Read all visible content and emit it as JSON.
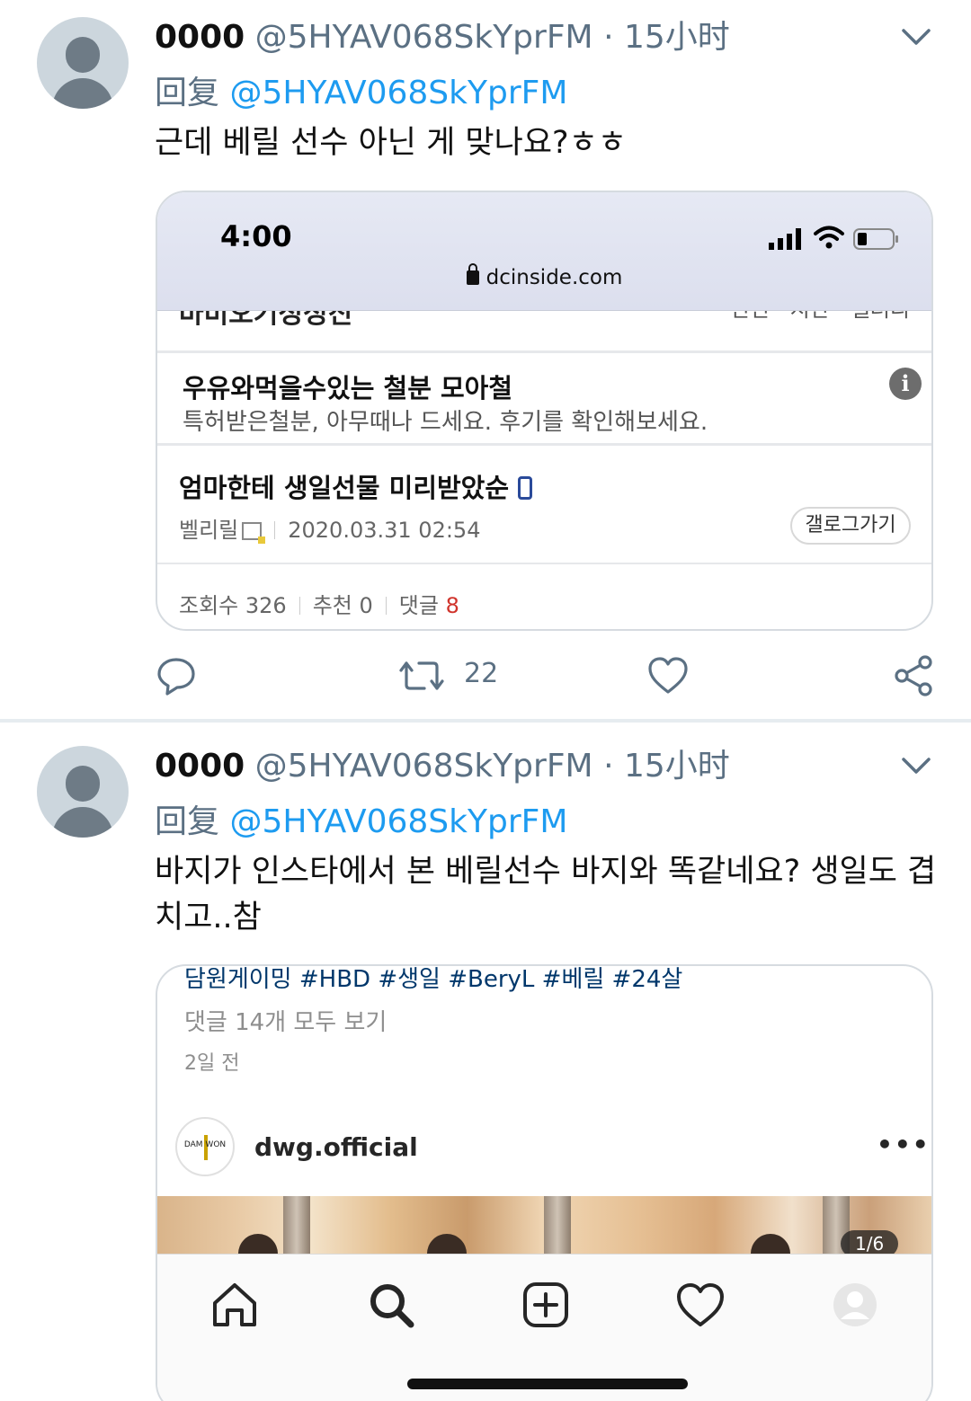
{
  "tweets": [
    {
      "name": "0000",
      "handle": "@5HYAV068SkYprFM",
      "dot": "·",
      "time": "15小时",
      "reply_word": "回复",
      "reply_to": "@5HYAV068SkYprFM",
      "text": "근데 베릴 선수 아닌 게 맞나요?ㅎㅎ"
    },
    {
      "name": "0000",
      "handle": "@5HYAV068SkYprFM",
      "dot": "·",
      "time": "15小时",
      "reply_word": "回复",
      "reply_to": "@5HYAV068SkYprFM",
      "text": "바지가 인스타에서 본 베릴선수 바지와 똑같네요? 생일도 겹치고..참"
    }
  ],
  "card1": {
    "clock": "4:00",
    "url": "dcinside.com",
    "cut_text": "바비오기정정진",
    "cut_right": "년선 · 지난 · 갤러리",
    "ad_title": "우유와먹을수있는 철분 모아철",
    "ad_desc": "특허받은철분, 아무때나 드세요. 후기를 확인해보세요.",
    "ad_info": "i",
    "post_title": "엄마한테 생일선물 미리받았순",
    "author": "벨리릴",
    "datetime": "2020.03.31 02:54",
    "gallery_button": "갤로그가기",
    "views_label": "조회수 326",
    "recommend_label": "추천 0",
    "comments_label": "댓글",
    "comments_count": "8"
  },
  "actions": {
    "retweet_count": "22",
    "icons": [
      "comment-icon",
      "retweet-icon",
      "like-icon",
      "share-icon"
    ]
  },
  "card2": {
    "tags": "담원게이밍 #HBD #생일 #BeryL #베릴 #24살",
    "comments_link": "댓글 14개 모두 보기",
    "time_ago": "2일 전",
    "logo_text": "DAM WON",
    "account": "dwg.official",
    "more": "•••",
    "page_indicator": "1/6",
    "nav_icons": [
      "home-icon",
      "search-icon",
      "new-post-icon",
      "activity-heart-icon",
      "profile-icon"
    ]
  },
  "colors": {
    "link_blue": "#1d9bf0",
    "muted_gray": "#5b7083",
    "comment_red": "#d0342c"
  }
}
